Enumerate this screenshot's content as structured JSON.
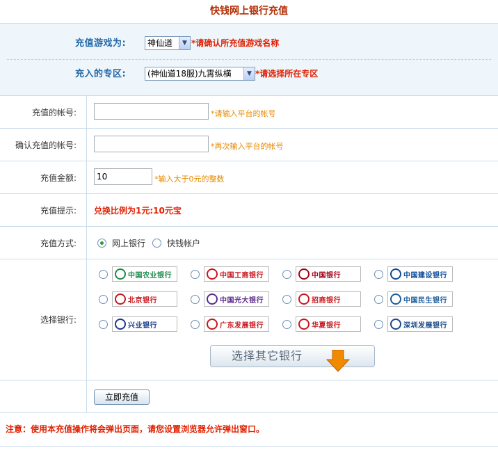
{
  "title": "快钱网上银行充值",
  "game": {
    "label": "充值游戏为:",
    "selected": "神仙道",
    "hint": "*请确认所充值游戏名称"
  },
  "zone": {
    "label": "充入的专区:",
    "selected": "(神仙道18服)九霄纵横",
    "hint": "*请选择所在专区"
  },
  "account": {
    "label": "充值的帐号:",
    "value": "",
    "hint": "*请输入平台的帐号"
  },
  "confirm_account": {
    "label": "确认充值的帐号:",
    "value": "",
    "hint": "*再次输入平台的帐号"
  },
  "amount": {
    "label": "充值金额:",
    "value": "10",
    "hint": "*输入大于0元的整数"
  },
  "tip": {
    "label": "充值提示:",
    "text": "兑换比例为1元:10元宝"
  },
  "method": {
    "label": "充值方式:",
    "options": [
      "网上银行",
      "快钱帐户"
    ],
    "selected_index": 0
  },
  "bank": {
    "label": "选择银行:",
    "banks": [
      {
        "name": "中国农业银行",
        "color": "#1a8a4a",
        "icon": "abc-bank-logo"
      },
      {
        "name": "中国工商银行",
        "color": "#c8161d",
        "icon": "icbc-bank-logo"
      },
      {
        "name": "中国银行",
        "color": "#a3001a",
        "icon": "boc-bank-logo"
      },
      {
        "name": "中国建设银行",
        "color": "#0a4a9a",
        "icon": "ccb-bank-logo"
      },
      {
        "name": "北京银行",
        "color": "#c8161d",
        "icon": "bob-bank-logo"
      },
      {
        "name": "中国光大银行",
        "color": "#5a2a8a",
        "icon": "ceb-bank-logo"
      },
      {
        "name": "招商银行",
        "color": "#c8161d",
        "icon": "cmb-bank-logo"
      },
      {
        "name": "中国民生银行",
        "color": "#1a5a9a",
        "icon": "cmbc-bank-logo"
      },
      {
        "name": "兴业银行",
        "color": "#1a3a8a",
        "icon": "cib-bank-logo"
      },
      {
        "name": "广东发展银行",
        "color": "#c8161d",
        "icon": "gdb-bank-logo"
      },
      {
        "name": "华夏银行",
        "color": "#c8161d",
        "icon": "hxb-bank-logo"
      },
      {
        "name": "深圳发展银行",
        "color": "#1a4a8a",
        "icon": "sdb-bank-logo"
      }
    ],
    "other_button": "选择其它银行"
  },
  "submit": "立即充值",
  "notice": "注意：使用本充值操作将会弹出页面，请您设置浏览器允许弹出窗口。",
  "colors": {
    "accent_red": "#e02000",
    "label_blue": "#2368a8",
    "hint_orange": "#e68a00",
    "border": "#c9dcec",
    "panel_bg": "#eef6fb",
    "radio_green": "#2e9b2e"
  }
}
